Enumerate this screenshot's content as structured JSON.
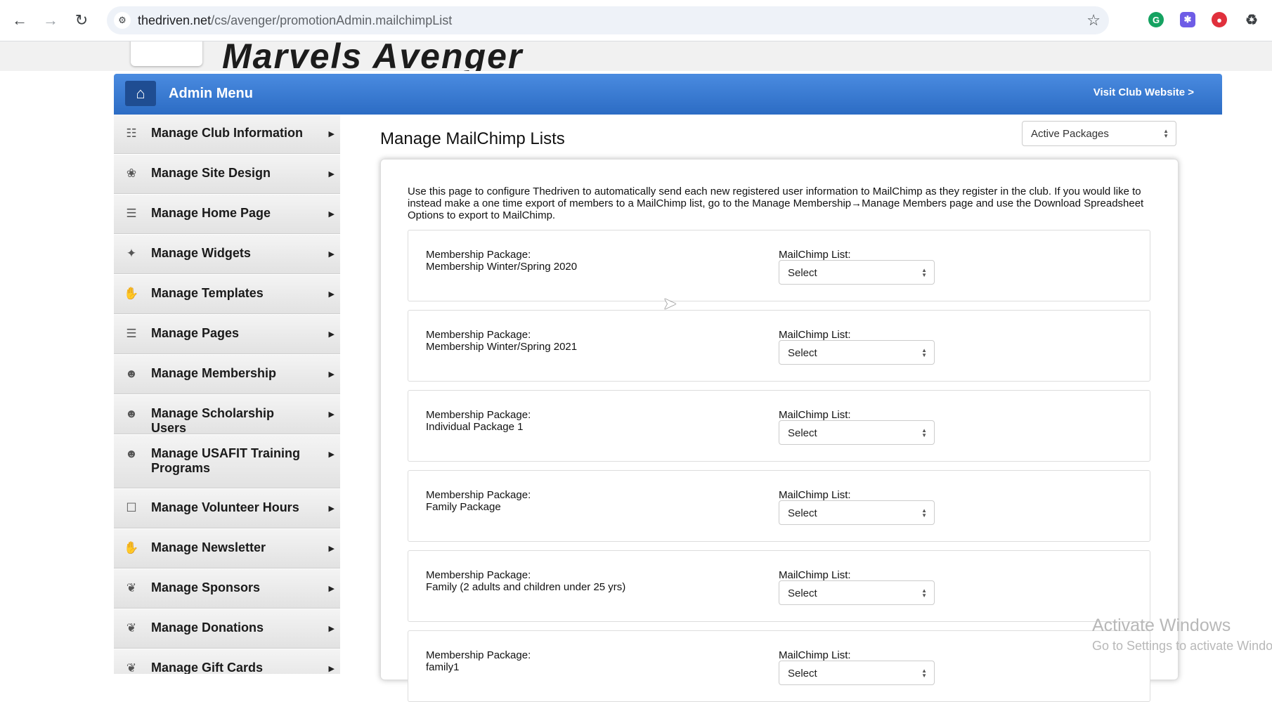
{
  "browser": {
    "url_domain": "thedriven.net",
    "url_path": "/cs/avenger/promotionAdmin.mailchimpList",
    "back_icon": "back-arrow-icon",
    "forward_icon": "forward-arrow-icon",
    "reload_icon": "reload-icon"
  },
  "site": {
    "title": "Marvels Avenger"
  },
  "admin_bar": {
    "title": "Admin Menu",
    "visit_link": "Visit Club Website >"
  },
  "sidebar": {
    "items": [
      {
        "label": "Manage Club Information",
        "icon": "document-icon"
      },
      {
        "label": "Manage Site Design",
        "icon": "palette-icon"
      },
      {
        "label": "Manage Home Page",
        "icon": "page-icon"
      },
      {
        "label": "Manage Widgets",
        "icon": "puzzle-icon"
      },
      {
        "label": "Manage Templates",
        "icon": "hand-icon"
      },
      {
        "label": "Manage Pages",
        "icon": "page-icon"
      },
      {
        "label": "Manage Membership",
        "icon": "user-icon"
      },
      {
        "label": "Manage Scholarship Users",
        "icon": "user-icon"
      },
      {
        "label": "Manage USAFIT Training Programs",
        "icon": "user-icon"
      },
      {
        "label": "Manage Volunteer Hours",
        "icon": "calendar-icon"
      },
      {
        "label": "Manage Newsletter",
        "icon": "hand-icon"
      },
      {
        "label": "Manage Sponsors",
        "icon": "handshake-icon"
      },
      {
        "label": "Manage Donations",
        "icon": "handshake-icon"
      },
      {
        "label": "Manage Gift Cards",
        "icon": "handshake-icon"
      }
    ]
  },
  "main": {
    "title": "Manage MailChimp Lists",
    "filter_value": "Active Packages",
    "intro": "Use this page to configure Thedriven to automatically send each new registered user information to MailChimp as they register in the club. If you would like to instead make a one time export of members to a MailChimp list, go to the Manage Membership→Manage Members page and use the Download Spreadsheet Options to export to MailChimp.",
    "package_prefix": "Membership Package:",
    "list_label": "MailChimp List:",
    "select_value": "Select",
    "packages": [
      "Membership Winter/Spring 2020",
      "Membership Winter/Spring 2021",
      "Individual Package 1",
      "Family Package",
      "Family (2 adults and children under 25 yrs)",
      "family1"
    ]
  },
  "watermark": {
    "line1": "Activate Windows",
    "line2": "Go to Settings to activate Windows."
  }
}
